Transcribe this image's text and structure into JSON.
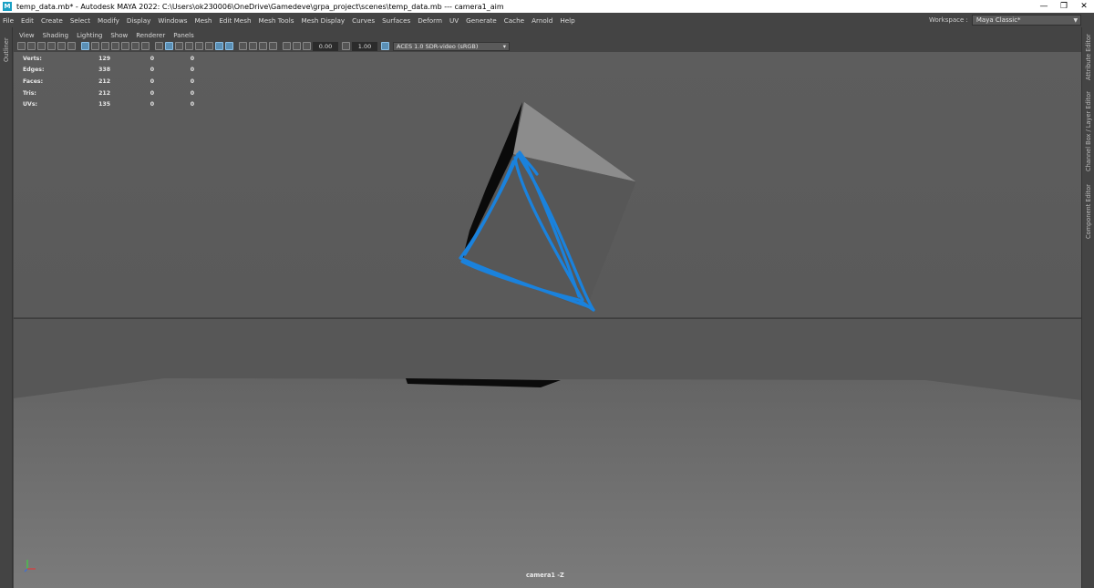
{
  "window": {
    "title": "temp_data.mb* - Autodesk MAYA 2022: C:\\Users\\ok230006\\OneDrive\\Gamedeve\\grpa_project\\scenes\\temp_data.mb   ---   camera1_aim",
    "icon_letter": "M",
    "minimize": "—",
    "maximize": "❐",
    "close": "✕"
  },
  "menubar": {
    "items": [
      "File",
      "Edit",
      "Create",
      "Select",
      "Modify",
      "Display",
      "Windows",
      "Mesh",
      "Edit Mesh",
      "Mesh Tools",
      "Mesh Display",
      "Curves",
      "Surfaces",
      "Deform",
      "UV",
      "Generate",
      "Cache",
      "Arnold",
      "Help"
    ]
  },
  "workspace": {
    "label": "Workspace :",
    "value": "Maya Classic*"
  },
  "side_tabs": {
    "left": "Outliner",
    "right": [
      "Attribute Editor",
      "Channel Box / Layer Editor",
      "Component Editor"
    ]
  },
  "panel_menu": [
    "View",
    "Shading",
    "Lighting",
    "Show",
    "Renderer",
    "Panels"
  ],
  "panel_toolbar": {
    "exposure": "0.00",
    "gamma": "1.00",
    "color_space": "ACES 1.0 SDR-video (sRGB)"
  },
  "hud": {
    "rows": [
      {
        "label": "Verts:",
        "v1": "129",
        "v2": "0",
        "v3": "0"
      },
      {
        "label": "Edges:",
        "v1": "338",
        "v2": "0",
        "v3": "0"
      },
      {
        "label": "Faces:",
        "v1": "212",
        "v2": "0",
        "v3": "0"
      },
      {
        "label": "Tris:",
        "v1": "212",
        "v2": "0",
        "v3": "0"
      },
      {
        "label": "UVs:",
        "v1": "135",
        "v2": "0",
        "v3": "0"
      }
    ]
  },
  "camera_label": "camera1 -Z",
  "colors": {
    "viewport_bg": "#5b5b5b",
    "ground": "#6e6e6e",
    "stroke_blue": "#1a82dd"
  }
}
